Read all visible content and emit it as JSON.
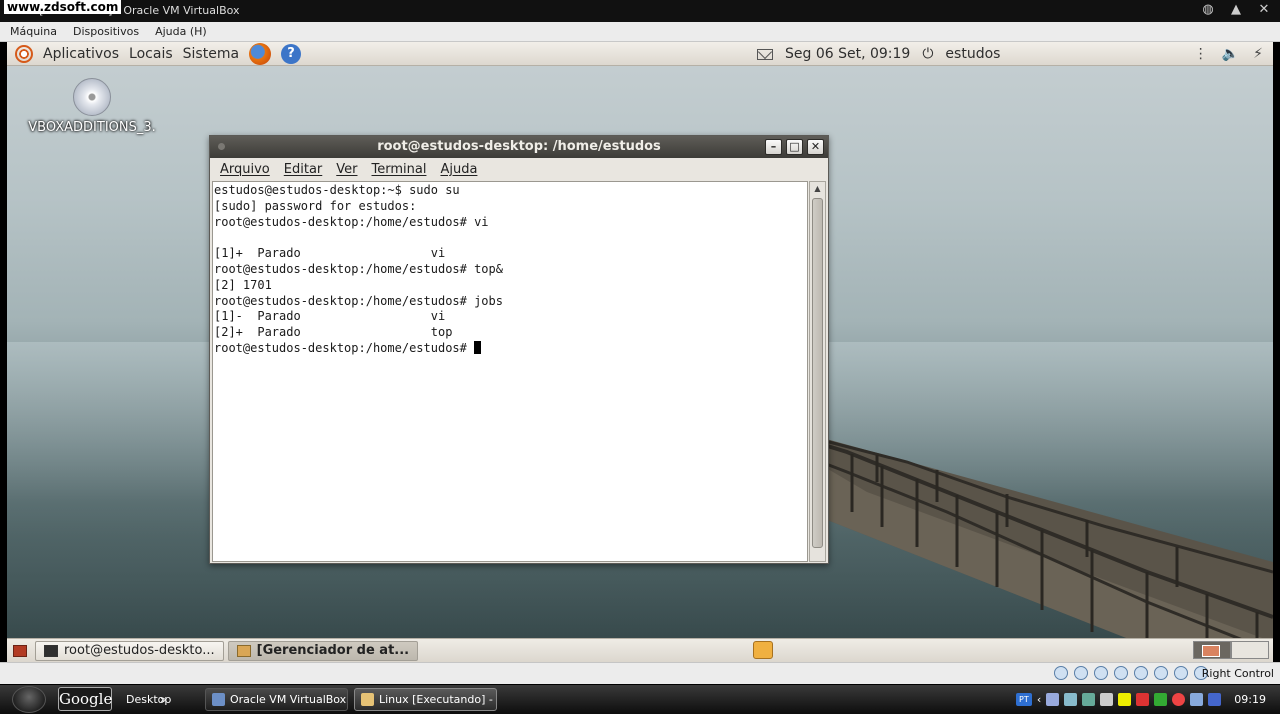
{
  "host": {
    "title": "Linux [Executando] - Oracle VM VirtualBox",
    "watermark": "www.zdsoft.com",
    "menu": [
      "Máquina",
      "Dispositivos",
      "Ajuda (H)"
    ],
    "status_right": "Right Control"
  },
  "gnome_panel": {
    "menus": [
      "Aplicativos",
      "Locais",
      "Sistema"
    ],
    "datetime": "Seg 06 Set, 09:19",
    "user": "estudos"
  },
  "desktop_icon": {
    "label": "VBOXADDITIONS_3."
  },
  "terminal": {
    "title": "root@estudos-desktop: /home/estudos",
    "menu": [
      "Arquivo",
      "Editar",
      "Ver",
      "Terminal",
      "Ajuda"
    ],
    "lines": [
      "estudos@estudos-desktop:~$ sudo su",
      "[sudo] password for estudos:",
      "root@estudos-desktop:/home/estudos# vi",
      "",
      "[1]+  Parado                  vi",
      "root@estudos-desktop:/home/estudos# top&",
      "[2] 1701",
      "root@estudos-desktop:/home/estudos# jobs",
      "[1]-  Parado                  vi",
      "[2]+  Parado                  top"
    ],
    "prompt": "root@estudos-desktop:/home/estudos# "
  },
  "bottom_panel": {
    "tasks": [
      "root@estudos-deskto...",
      "[Gerenciador de at..."
    ]
  },
  "win_taskbar": {
    "google": "Google",
    "desktop": "Desktop",
    "buttons": [
      "Oracle VM VirtualBox",
      "Linux [Executando] - ..."
    ],
    "clock": "09:19",
    "lang": "PT"
  },
  "colors": {
    "terminal_titlebar": "#3c3b37",
    "panel_bg": "#ddd8cf",
    "sky": "#b6c3c6",
    "water": "#324446"
  }
}
